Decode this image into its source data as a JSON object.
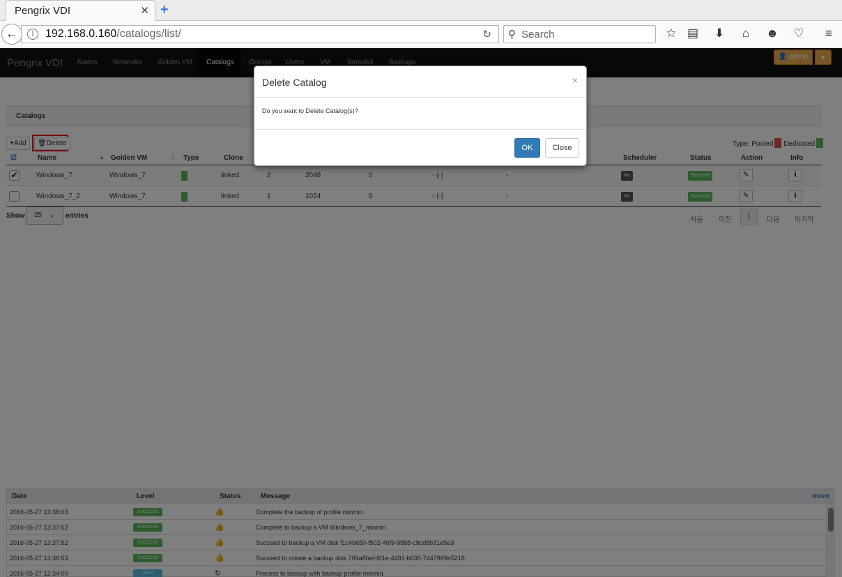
{
  "browser": {
    "tab_title": "Pengrix VDI",
    "url_host": "192.168.0.160",
    "url_path": "/catalogs/list/",
    "search_placeholder": "Search"
  },
  "app": {
    "brand": "Pengrix VDI",
    "nav": [
      "Nodes",
      "Networks",
      "Golden VM",
      "Catalogs",
      "Groups",
      "Users",
      "VM",
      "Webdisk",
      "Backups"
    ],
    "active_nav": "Catalogs",
    "user_label": "admin"
  },
  "panel": {
    "title": "Catalogs"
  },
  "toolbar": {
    "add_label": "Add",
    "delete_label": "Delete"
  },
  "legend": {
    "type_label": "Type: Pooled",
    "dedicated_label": "Dedicated",
    "pooled_color": "#d9534f",
    "dedicated_color": "#5cb85c"
  },
  "table": {
    "columns": [
      "Name",
      "Golden VM",
      "Type",
      "Clone",
      "Scheduler",
      "Status",
      "Action",
      "Info"
    ],
    "rows": [
      {
        "checked": true,
        "name": "Windows_7",
        "golden_vm": "Windows_7",
        "clone": "linked",
        "c1": "2",
        "c2": "2048",
        "c3": "0",
        "c4": "- (-)",
        "c5": "-",
        "scheduler": "No",
        "status": "Succeed"
      },
      {
        "checked": false,
        "name": "Windows_7_2",
        "golden_vm": "Windows_7",
        "clone": "linked",
        "c1": "1",
        "c2": "1024",
        "c3": "0",
        "c4": "- (-)",
        "c5": "-",
        "scheduler": "No",
        "status": "Succeed"
      }
    ]
  },
  "paging": {
    "show_label": "Show",
    "page_size": "25",
    "entries_label": "entries",
    "first": "처음",
    "prev": "이전",
    "current": "1",
    "next": "다음",
    "last": "마지막"
  },
  "log": {
    "columns": [
      "Date",
      "Level",
      "Status",
      "Message"
    ],
    "more_label": "more",
    "rows": [
      {
        "date": "2016-05-27 13:38:03",
        "level": "SUCCESS",
        "message": "Complete the backup of profile minmin"
      },
      {
        "date": "2016-05-27 13:37:52",
        "level": "SUCCESS",
        "message": "Complete to backup a VM Windows_7_minmin"
      },
      {
        "date": "2016-05-27 13:37:52",
        "level": "SUCCESS",
        "message": "Succeed to backup a VM disk f1c4b650-f502-46f9-9588-c9cd8b31e5e3"
      },
      {
        "date": "2016-05-27 13:36:53",
        "level": "SUCCESS",
        "message": "Succeed to create a backup disk 709a8bef-6f1e-4491-b635-7447969e5218."
      },
      {
        "date": "2016-05-27 12:34:00",
        "level": "INFO",
        "message": "Process to backup with backup profile minmin."
      }
    ]
  },
  "modal": {
    "title": "Delete Catalog",
    "close_symbol": "×",
    "body": "Do you want to Delete Catalog(s)?",
    "ok_label": "OK",
    "close_label": "Close"
  }
}
